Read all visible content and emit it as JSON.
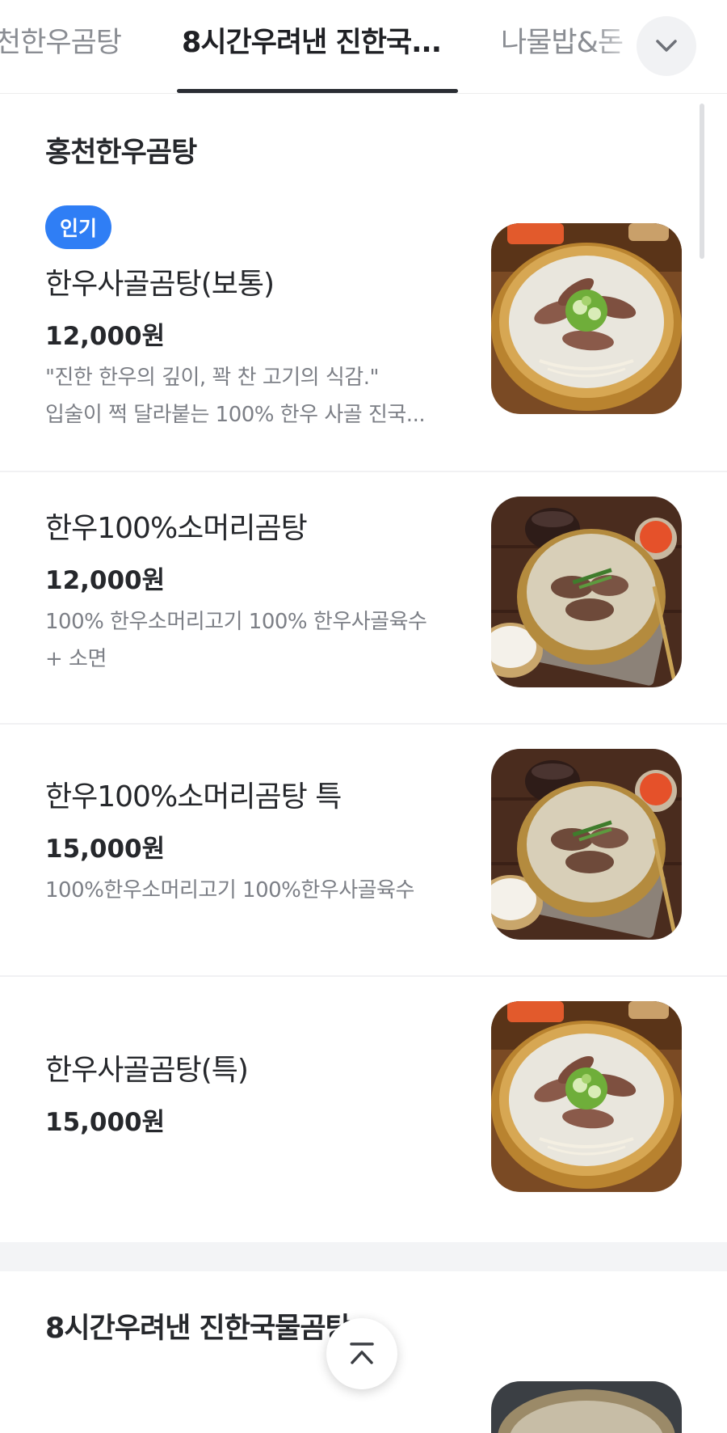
{
  "tabs": [
    {
      "label": "홍천한우곰탕",
      "visible_label": "천한우곰탕"
    },
    {
      "label": "8시간우려낸 진한국...",
      "active": true
    },
    {
      "label": "나물밥&돈"
    }
  ],
  "sections": [
    {
      "title": "홍천한우곰탕",
      "items": [
        {
          "badge": "인기",
          "name": "한우사골곰탕(보통)",
          "price": "12,000원",
          "desc": [
            "\"진한 한우의 깊이, 꽉 찬 고기의 식감.\"",
            "입술이 쩍 달라붙는 100% 한우 사골 진국..."
          ],
          "image": "bone-broth-soup-bowl"
        },
        {
          "name": "한우100%소머리곰탕",
          "price": "12,000원",
          "desc": [
            "100% 한우소머리고기 100% 한우사골육수",
            "+ 소면"
          ],
          "image": "beef-head-soup-table"
        },
        {
          "name": "한우100%소머리곰탕 특",
          "price": "15,000원",
          "desc": [
            "100%한우소머리고기 100%한우사골육수"
          ],
          "image": "beef-head-soup-table"
        },
        {
          "name": "한우사골곰탕(특)",
          "price": "15,000원",
          "desc": [],
          "image": "bone-broth-soup-bowl"
        }
      ]
    },
    {
      "title": "8시간우려낸 진한국물곰탕"
    }
  ],
  "icons": {
    "tab_more": "chevron-down-icon",
    "scroll_top": "chevron-up-icon"
  },
  "colors": {
    "badge": "#2f7ef5",
    "active_tab": "#1f2024",
    "inactive_tab": "#8a8d93",
    "price": "#26282c",
    "desc": "#7c7f86"
  }
}
